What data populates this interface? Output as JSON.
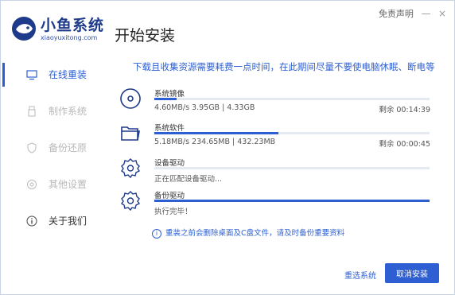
{
  "brand": {
    "title": "小鱼系统",
    "subtitle": "xiaoyuxitong.com"
  },
  "page_title": "开始安装",
  "topbar": {
    "disclaimer": "免责声明",
    "minimize": "—",
    "close": "×"
  },
  "sidebar": {
    "items": [
      {
        "label": "在线重装",
        "icon": "monitor-icon",
        "state": "active"
      },
      {
        "label": "制作系统",
        "icon": "usb-icon",
        "state": "disabled"
      },
      {
        "label": "备份还原",
        "icon": "shield-icon",
        "state": "disabled"
      },
      {
        "label": "其他设置",
        "icon": "settings-icon",
        "state": "disabled"
      },
      {
        "label": "关于我们",
        "icon": "info-icon",
        "state": "normal"
      }
    ]
  },
  "notice": "下载且收集资源需要耗费一点时间，在此期间尽量不要使电脑休眠、断电等",
  "tasks": [
    {
      "name": "系统镜像",
      "stats": "4.60MB/s 3.95GB | 4.33GB",
      "remain": "剩余 00:14:39",
      "progress": 0.08,
      "icon": "disc-icon"
    },
    {
      "name": "系统软件",
      "stats": "5.18MB/s 234.65MB | 432.23MB",
      "remain": "剩余 00:00:45",
      "progress": 0.45,
      "icon": "folder-icon"
    },
    {
      "name": "设备驱动",
      "stats": "正在匹配设备驱动...",
      "remain": "",
      "progress": 0.0,
      "icon": "gear-icon"
    },
    {
      "name": "备份驱动",
      "stats": "执行完毕！",
      "remain": "",
      "progress": 1.0,
      "icon": "gear-icon"
    }
  ],
  "warning": "重装之前会删除桌面及C盘文件，请及时备份重要资料",
  "buttons": {
    "reselect": "重选系统",
    "cancel": "取消安装"
  },
  "colors": {
    "accent": "#2d5fd3",
    "brand": "#1e3a8a"
  }
}
